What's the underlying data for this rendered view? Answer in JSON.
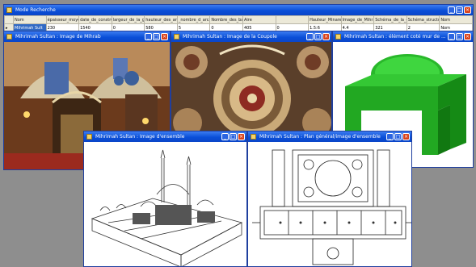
{
  "main_window": {
    "title": "Mode Recherche",
    "columns": [
      "Nom",
      "épaisseur_moyenne",
      "date_de_construct",
      "largeur_de_la_gale",
      "hauteur_des_arcs_",
      "_nombre_d_arcade",
      "Nombre_des_balco",
      "Aire",
      "",
      "Hauteur_Minaret_c",
      "Image_de_Mihrab",
      "Schéma_de_la_cor",
      "Schéma_structure",
      "Nom"
    ],
    "row": [
      "Mihrimah Sult",
      "230",
      "1540",
      "0",
      "580",
      "5",
      "0",
      "405",
      "0",
      "1.5:6",
      "4.4",
      "321",
      "2",
      "Nom"
    ],
    "row_marker": "▸"
  },
  "windows": {
    "mihrab": {
      "title": "Mihrimah Sultan  : Image de Mihrab"
    },
    "coupole": {
      "title": "Mihrimah Sultan  : Image de la Coupole"
    },
    "cote": {
      "title": "Mihrimah Sultan  : élément coté mur de ..."
    },
    "ensemble": {
      "title": "Mihrimah Sultan  : Image d'ensemble"
    },
    "plan": {
      "title": "Mihrimah Sultan  : Plan général/image d'ensemble"
    }
  },
  "buttons": {
    "minimize": "_",
    "maximize": "□",
    "close": "×"
  },
  "colors": {
    "titlebar": "#0a4fd8",
    "close": "#d8421a",
    "desktop": "#8e8e8e",
    "selected_cell": "#316ac5"
  }
}
